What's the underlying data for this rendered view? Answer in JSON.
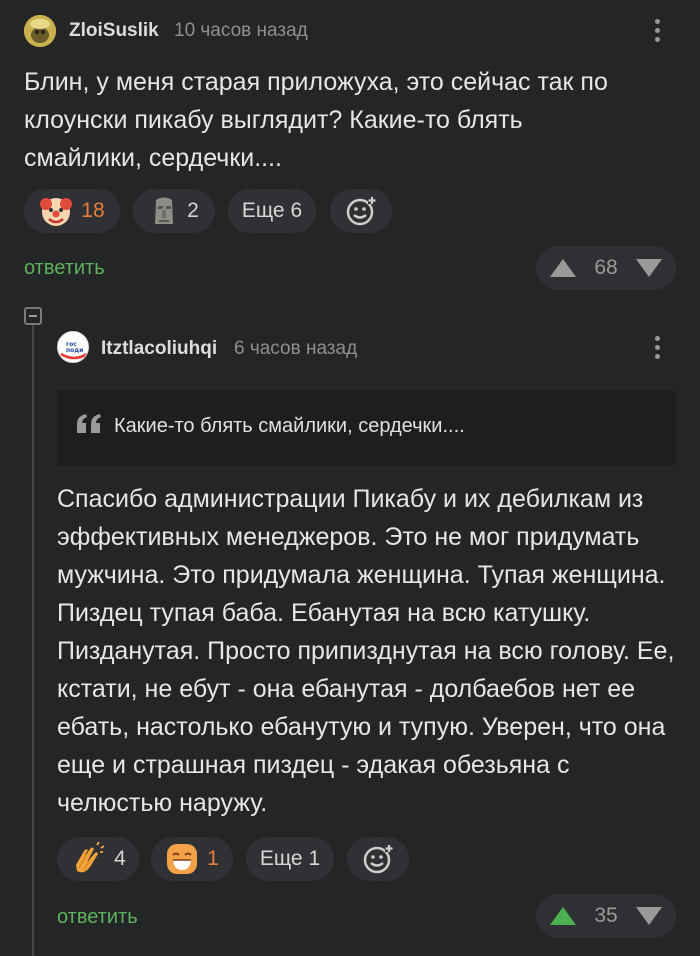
{
  "comment1": {
    "username": "ZloiSuslik",
    "time": "10 часов назад",
    "text": "Блин, у меня старая приложуха, это сейчас так по клоунски пикабу выглядит? Какие-то блять смайлики, сердечки....",
    "reactions": [
      {
        "icon": "clown-face-icon",
        "count": "18"
      },
      {
        "icon": "moai-icon",
        "count": "2"
      }
    ],
    "more_label": "Еще 6",
    "reply_label": "ответить",
    "rating": "68"
  },
  "comment2": {
    "username": "Itztlacoliuhqi",
    "avatar_text": "гос поди",
    "time": "6 часов назад",
    "quote": "Какие-то блять смайлики, сердечки....",
    "text": "Спасибо администрации Пикабу и их дебилкам из эффективных менеджеров. Это не мог придумать мужчина. Это придумала женщина. Тупая женщина. Пиздец тупая баба. Ебанутая на всю катушку. Пизданутая. Просто припизднутая на всю голову. Ее, кстати, не ебут - она ебанутая - долбаебов нет ее ебать, настолько ебанутую и тупую. Уверен, что она еще и страшная пиздец - эдакая обезьяна с челюстью наружу.",
    "reactions": [
      {
        "icon": "clapping-hands-icon",
        "count": "4"
      },
      {
        "icon": "grinning-face-icon",
        "count": "1"
      }
    ],
    "more_label": "Еще 1",
    "reply_label": "ответить",
    "rating": "35"
  },
  "colors": {
    "background": "#242527",
    "accent_green": "#4caf50",
    "hot_count": "#e87d3e"
  }
}
